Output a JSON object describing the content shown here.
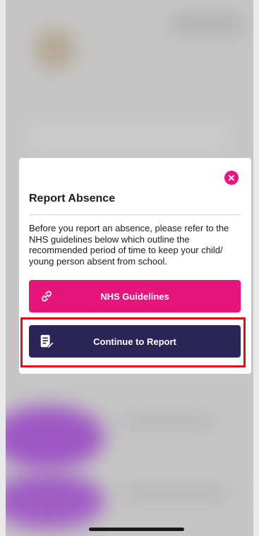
{
  "modal": {
    "title": "Report Absence",
    "message": "Before you report an absence, please refer to the NHS guidelines below which outline the recommended period of time to keep your child/ young person absent from school.",
    "close_icon": "close-icon",
    "buttons": [
      {
        "label": "NHS Guidelines",
        "icon": "link-icon",
        "color": "#e6157c"
      },
      {
        "label": "Continue to Report",
        "icon": "edit-document-icon",
        "color": "#2b2457"
      }
    ]
  },
  "colors": {
    "accent_pink": "#e6157c",
    "dark_navy": "#2b2457",
    "highlight_red": "#e01010"
  }
}
